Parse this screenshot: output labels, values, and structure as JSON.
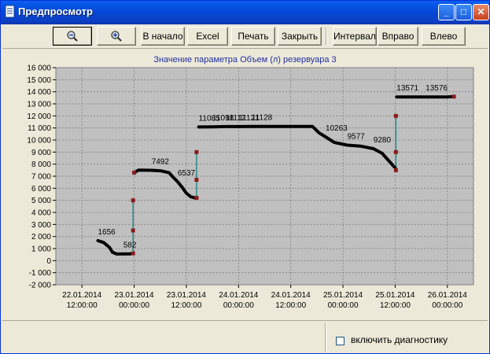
{
  "window": {
    "title": "Предпросмотр",
    "controls": {
      "minimize": "_",
      "maximize": "□",
      "close": "✕"
    }
  },
  "toolbar": {
    "zoom_out_icon": "zoom-out-icon",
    "zoom_in_icon": "zoom-in-icon",
    "home": "В начало",
    "excel": "Excel",
    "print": "Печать",
    "close": "Закрыть",
    "interval": "Интервал",
    "right": "Вправо",
    "left": "Влево"
  },
  "status": {
    "diagnostics_label": "включить диагностику",
    "diagnostics_checked": false
  },
  "colors": {
    "plot_bg": "#c0c0c0",
    "series": "#000000",
    "marker": "#8b1a1a",
    "connector": "#2a8a8a",
    "title": "#1f2ea8"
  },
  "chart_data": {
    "type": "line",
    "title": "Значение параметра Объем (л) резервуара 3",
    "xlabel": "",
    "ylabel": "",
    "ylim": [
      -2000,
      16000
    ],
    "yticks": [
      -2000,
      -1000,
      0,
      1000,
      2000,
      3000,
      4000,
      5000,
      6000,
      7000,
      8000,
      9000,
      10000,
      11000,
      12000,
      13000,
      14000,
      15000,
      16000
    ],
    "ytick_labels": [
      "-2 000",
      "-1 000",
      "0",
      "1 000",
      "2 000",
      "3 000",
      "4 000",
      "5 000",
      "6 000",
      "7 000",
      "8 000",
      "9 000",
      "10 000",
      "11 000",
      "12 000",
      "13 000",
      "14 000",
      "15 000",
      "16 000"
    ],
    "xlim": [
      "2014-01-22T06:00",
      "2014-01-26T06:00"
    ],
    "xticks": [
      "2014-01-22T12:00",
      "2014-01-23T00:00",
      "2014-01-23T12:00",
      "2014-01-24T00:00",
      "2014-01-24T12:00",
      "2014-01-25T00:00",
      "2014-01-25T12:00",
      "2014-01-26T00:00"
    ],
    "xtick_labels": [
      [
        "22.01.2014",
        "12:00:00"
      ],
      [
        "23.01.2014",
        "00:00:00"
      ],
      [
        "23.01.2014",
        "12:00:00"
      ],
      [
        "24.01.2014",
        "00:00:00"
      ],
      [
        "24.01.2014",
        "12:00:00"
      ],
      [
        "25.01.2014",
        "00:00:00"
      ],
      [
        "25.01.2014",
        "12:00:00"
      ],
      [
        "26.01.2014",
        "00:00:00"
      ]
    ],
    "grid": true,
    "segments": [
      [
        [
          "2014-01-22T15:40",
          1656
        ],
        [
          "2014-01-22T17:00",
          1500
        ],
        [
          "2014-01-22T18:20",
          1100
        ],
        [
          "2014-01-22T19:00",
          700
        ],
        [
          "2014-01-22T20:00",
          550
        ],
        [
          "2014-01-22T22:00",
          560
        ],
        [
          "2014-01-22T23:00",
          560
        ],
        [
          "2014-01-22T23:30",
          580
        ]
      ],
      [
        [
          "2014-01-23T00:00",
          7300
        ],
        [
          "2014-01-23T01:00",
          7500
        ],
        [
          "2014-01-23T04:00",
          7492
        ],
        [
          "2014-01-23T06:00",
          7450
        ],
        [
          "2014-01-23T08:00",
          7300
        ],
        [
          "2014-01-23T09:00",
          6900
        ],
        [
          "2014-01-23T10:00",
          6537
        ],
        [
          "2014-01-23T11:00",
          6100
        ],
        [
          "2014-01-23T12:00",
          5600
        ],
        [
          "2014-01-23T13:00",
          5300
        ],
        [
          "2014-01-23T14:00",
          5200
        ]
      ],
      [
        [
          "2014-01-23T14:50",
          11085
        ],
        [
          "2014-01-23T18:00",
          11098
        ],
        [
          "2014-01-23T21:00",
          11112
        ],
        [
          "2014-01-24T00:00",
          11112
        ],
        [
          "2014-01-24T03:00",
          11121
        ],
        [
          "2014-01-24T06:00",
          11128
        ],
        [
          "2014-01-24T12:00",
          11128
        ],
        [
          "2014-01-24T17:00",
          11128
        ],
        [
          "2014-01-24T18:30",
          10600
        ],
        [
          "2014-01-24T20:00",
          10263
        ],
        [
          "2014-01-24T22:00",
          9800
        ],
        [
          "2014-01-25T01:00",
          9577
        ],
        [
          "2014-01-25T04:00",
          9500
        ],
        [
          "2014-01-25T07:00",
          9280
        ],
        [
          "2014-01-25T09:00",
          8900
        ],
        [
          "2014-01-25T10:30",
          8300
        ],
        [
          "2014-01-25T12:00",
          7700
        ]
      ],
      [
        [
          "2014-01-25T12:20",
          13571
        ],
        [
          "2014-01-25T15:00",
          13571
        ],
        [
          "2014-01-25T19:00",
          13576
        ],
        [
          "2014-01-26T00:00",
          13576
        ],
        [
          "2014-01-26T01:30",
          13600
        ]
      ]
    ],
    "connectors": [
      [
        "2014-01-22T23:45",
        580,
        "2014-01-22T23:45",
        5000
      ],
      [
        "2014-01-23T14:20",
        5200,
        "2014-01-23T14:20",
        9000
      ],
      [
        "2014-01-25T12:10",
        7500,
        "2014-01-25T12:10",
        12000
      ]
    ],
    "markers": [
      [
        "2014-01-22T23:45",
        5000
      ],
      [
        "2014-01-22T23:45",
        2500
      ],
      [
        "2014-01-22T23:45",
        600
      ],
      [
        "2014-01-23T00:00",
        7300
      ],
      [
        "2014-01-23T14:20",
        9000
      ],
      [
        "2014-01-23T14:20",
        6700
      ],
      [
        "2014-01-23T14:20",
        5200
      ],
      [
        "2014-01-25T12:10",
        12000
      ],
      [
        "2014-01-25T12:10",
        9000
      ],
      [
        "2014-01-25T12:10",
        7500
      ],
      [
        "2014-01-26T01:30",
        13600
      ]
    ],
    "annotations": [
      {
        "text": "1656",
        "x": "2014-01-22T15:40",
        "y": 1656
      },
      {
        "text": "582",
        "x": "2014-01-22T21:30",
        "y": 582
      },
      {
        "text": "7492",
        "x": "2014-01-23T04:00",
        "y": 7492
      },
      {
        "text": "6537",
        "x": "2014-01-23T10:00",
        "y": 6537
      },
      {
        "text": "11085",
        "x": "2014-01-23T14:50",
        "y": 11085
      },
      {
        "text": "11098",
        "x": "2014-01-23T18:00",
        "y": 11098
      },
      {
        "text": "11112",
        "x": "2014-01-23T21:00",
        "y": 11112
      },
      {
        "text": "11121",
        "x": "2014-01-24T00:00",
        "y": 11121
      },
      {
        "text": "11128",
        "x": "2014-01-24T03:00",
        "y": 11128
      },
      {
        "text": "10263",
        "x": "2014-01-24T20:00",
        "y": 10263
      },
      {
        "text": "9577",
        "x": "2014-01-25T01:00",
        "y": 9577
      },
      {
        "text": "9280",
        "x": "2014-01-25T07:00",
        "y": 9280
      },
      {
        "text": "13571",
        "x": "2014-01-25T12:20",
        "y": 13571
      },
      {
        "text": "13576",
        "x": "2014-01-25T19:00",
        "y": 13576
      }
    ]
  }
}
